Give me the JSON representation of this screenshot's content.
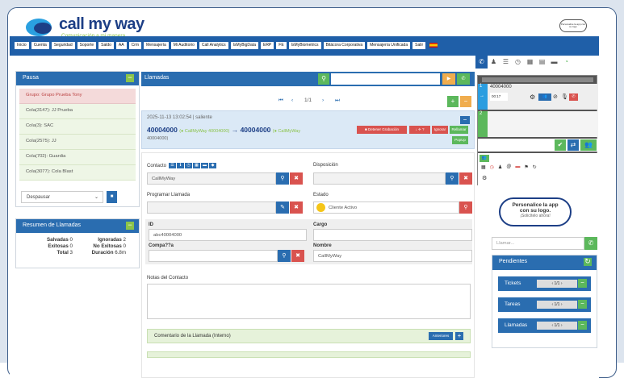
{
  "brand": {
    "name": "call my way",
    "tagline": "Comunicación a mi manera",
    "badge": "Personalice la app con su logo"
  },
  "menu": [
    "Inicio",
    "Cuenta",
    "Seguridad",
    "Soporte",
    "Saldo",
    "AA",
    "Crm",
    "Mensajería",
    "Mi Auditorio",
    "Call Analytics",
    "IsMyBigData",
    "ERP",
    "FE",
    "IsMyBiometrics",
    "Bitácora Corporativa",
    "Mensajería Unificada",
    "Salir"
  ],
  "pause": {
    "title": "Pausa",
    "queues": [
      "Grupo: Grupo Prueba Tony",
      "Cola(3147): JJ Prueba",
      "Cola(3): SAC",
      "Cola(2575): JJ",
      "Cola(702): Guardia",
      "Cola(3077): Cola Blast"
    ],
    "select": "Despausar"
  },
  "summary": {
    "title": "Resumen de Llamadas",
    "saved_label": "Salvadas",
    "saved": "0",
    "ignored_label": "Ignoradas",
    "ignored": "2",
    "success_label": "Exitosas",
    "success": "0",
    "nosuccess_label": "No Exitosas",
    "nosuccess": "0",
    "total_label": "Total",
    "total": "3",
    "duration_label": "Duración",
    "duration": "6.8m"
  },
  "calls": {
    "title": "Llamadas",
    "pager": "1/1",
    "header": "2025-11-13 13:02:54 | saliente",
    "from": "40004000",
    "from_detail": "(● CallMyWay 40004000)",
    "arrow": "→",
    "to": "40004000",
    "to_detail": "(● CallMyWay",
    "to_detail2": "40004000)",
    "btn_stop": "■ Detener Grabación",
    "btn_transfer": "↓ ✈ ?",
    "btn_ignore": "Ignorar",
    "btn_recall": "Rellamar",
    "btn_popup": "PopUp"
  },
  "form": {
    "contact_label": "Contacto",
    "contact_value": "CallMyWay",
    "disposition_label": "Disposición",
    "schedule_label": "Programar Llamada",
    "status_label": "Estado",
    "status_value": "Cliente Activo",
    "id_label": "ID",
    "id_value": "abc40004000",
    "cargo_label": "Cargo",
    "company_label": "Compa??a",
    "name_label": "Nombre",
    "name_value": "CallMyWay",
    "notes_label": "Notas del Contacto",
    "comment_label": "Comentario de la Llamada (Interno)",
    "prev_btn": "Anteriores"
  },
  "phone": {
    "line1": "40004000",
    "timer": "00:17",
    "line2": "2"
  },
  "promo": {
    "line1": "Personalice la app",
    "line2": "con su logo.",
    "line3": "¡Solicítelo ahora!"
  },
  "dial": {
    "placeholder": "Llamar..."
  },
  "pending": {
    "title": "Pendientes",
    "items": [
      {
        "label": "Tickets",
        "page": "1/1"
      },
      {
        "label": "Tareas",
        "page": "1/1"
      },
      {
        "label": "Llamadas",
        "page": "1/1"
      }
    ]
  }
}
